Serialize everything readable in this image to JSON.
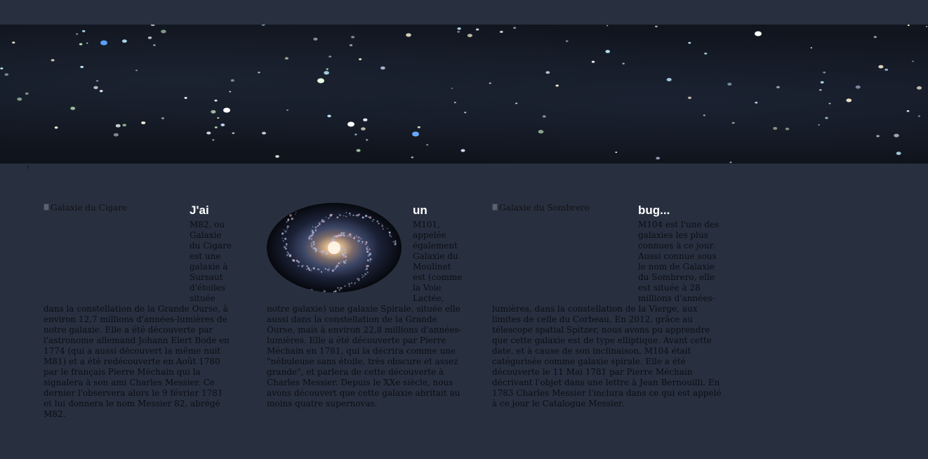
{
  "banner": {
    "alt": "starry sky banner"
  },
  "stray_mark": "!",
  "articles": [
    {
      "image_alt": "Galaxie du Cigare",
      "heading": "J'ai",
      "text": "M82, ou Galaxie du Cigare est une galaxie à Sursaut d'étoiles située dans la constellation de la Grande Ourse, à environ 12,7 millions d'années-lumières de notre galaxie. Elle a été découverte par l'astronome allemand Johann Elert Bode en 1774 (qui a aussi découvert la même nuit M81) et a été redécouverte en Août 1780 par le français Pierre Méchain qui la signalera à son ami Charles Messier. Ce dernier l'observera alors le 9 février 1781 et lui donnera le nom Messier 82, abrégé M82."
    },
    {
      "image_alt": "Galaxie du Moulinet",
      "heading": "un",
      "text": "M101, appelée également Galaxie du Moulinet est (comme la Voie Lactée, notre galaxie) une galaxie Spirale, située elle aussi dans la constellation de la Grande Ourse, mais à environ 22,8 millions d'années-lumières. Elle a été découverte par Pierre Méchain en 1781, qui la décrira comme une \"nébuleuse sans étoile, très obscure et assez grande\", et parlera de cette découverte à Charles Messier. Depuis le XXe siècle, nous avons découvert que cette galaxie abritait au moins quatre supernovas."
    },
    {
      "image_alt": "Galaxie du Sombrero",
      "heading": "bug...",
      "text": "M104 est l'une des galaxies les plus connues à ce jour. Aussi connue sous le nom de Galaxie du Sombrero, elle est située à 28 millions d'années-lumières, dans la constellation de la Vierge, aux limites de celle du Corbeau. En 2012, grâce au télescope spatial Spitzer, nous avons pu apprendre que cette galaxie est de type elliptique. Avant cette date, et à cause de son inclinaison, M104 était catégorisée comme galaxie spirale. Elle a été découverte le 11 Mai 1781 par Pierre Méchain décrivant l'objet dans une lettre à Jean Bernouilli. En 1783 Charles Messier l'inclura dans ce qui est appelé à ce jour le Catalogue Messier."
    }
  ]
}
